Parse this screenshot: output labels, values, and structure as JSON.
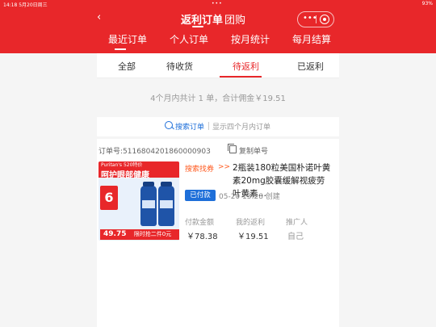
{
  "status_bar": {
    "time_date": "14:18  5月20日周三",
    "battery": "93%"
  },
  "header": {
    "back_icon": "‹",
    "title": "返利订单",
    "title2": "团购",
    "capsule": {
      "more_icon": "•••",
      "close_icon": "target-circle-icon"
    }
  },
  "tabs_primary": [
    {
      "label": "最近订单"
    },
    {
      "label": "个人订单"
    },
    {
      "label": "按月统计"
    },
    {
      "label": "每月结算"
    }
  ],
  "tabs_secondary": [
    {
      "label": "全部"
    },
    {
      "label": "待收货"
    },
    {
      "label": "待返利"
    },
    {
      "label": "已返利"
    }
  ],
  "summary": "4个月内共计 1 单，合计佣金￥19.51",
  "search": {
    "link": "搜索订单",
    "hint": "显示四个月内订单"
  },
  "order": {
    "order_no": "订单号:5116804201860000903",
    "copy_label": "复制单号",
    "source": "搜索找券",
    "source_arrow": ">>",
    "title": "2瓶装180粒美国朴诺叶黄素20mg胶囊缓解视疲劳叶黄素…",
    "status_badge": "已付款",
    "created": "05-20 13:28 创建",
    "fields": [
      {
        "label": "付款金额",
        "value": "￥78.38"
      },
      {
        "label": "我的返利",
        "value": "￥19.51"
      },
      {
        "label": "推广人",
        "value": "自己"
      }
    ],
    "thumbnail": {
      "banner_small": "Puritan's 520特价",
      "banner": "呵护眼部健康",
      "promo": "6",
      "price": "49.75",
      "tail": "限时抢二件0元"
    }
  },
  "colors": {
    "brand_red": "#e8272a",
    "link_blue": "#1e6fd9",
    "accent_orange": "#ff5a1f"
  }
}
